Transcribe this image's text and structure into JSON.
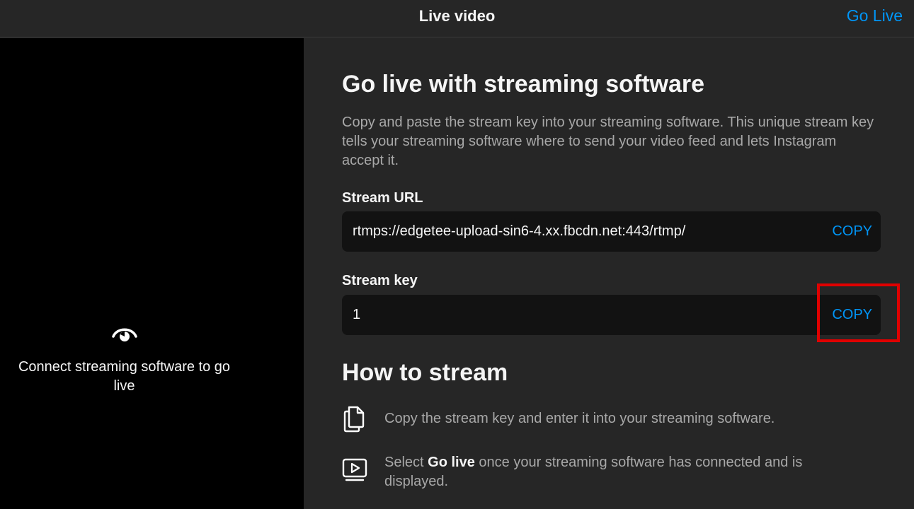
{
  "header": {
    "title": "Live video",
    "go_live": "Go Live"
  },
  "preview": {
    "message": "Connect streaming software to go live",
    "icon": "eye-icon"
  },
  "main": {
    "heading": "Go live with streaming software",
    "description": "Copy and paste the stream key into your streaming software. This unique stream key tells your streaming software where to send your video feed and lets Instagram accept it.",
    "stream_url": {
      "label": "Stream URL",
      "value": "rtmps://edgetee-upload-sin6-4.xx.fbcdn.net:443/rtmp/",
      "copy_label": "COPY"
    },
    "stream_key": {
      "label": "Stream key",
      "value": "1",
      "copy_label": "COPY"
    },
    "how_to_heading": "How to stream",
    "steps": [
      {
        "icon": "copy-icon",
        "text": "Copy the stream key and enter it into your streaming software."
      },
      {
        "icon": "video-play-icon",
        "prefix": "Select ",
        "bold": "Go live",
        "suffix": " once your streaming software has connected and is displayed."
      }
    ]
  },
  "colors": {
    "accent": "#0095f6",
    "highlight": "#e00000"
  }
}
